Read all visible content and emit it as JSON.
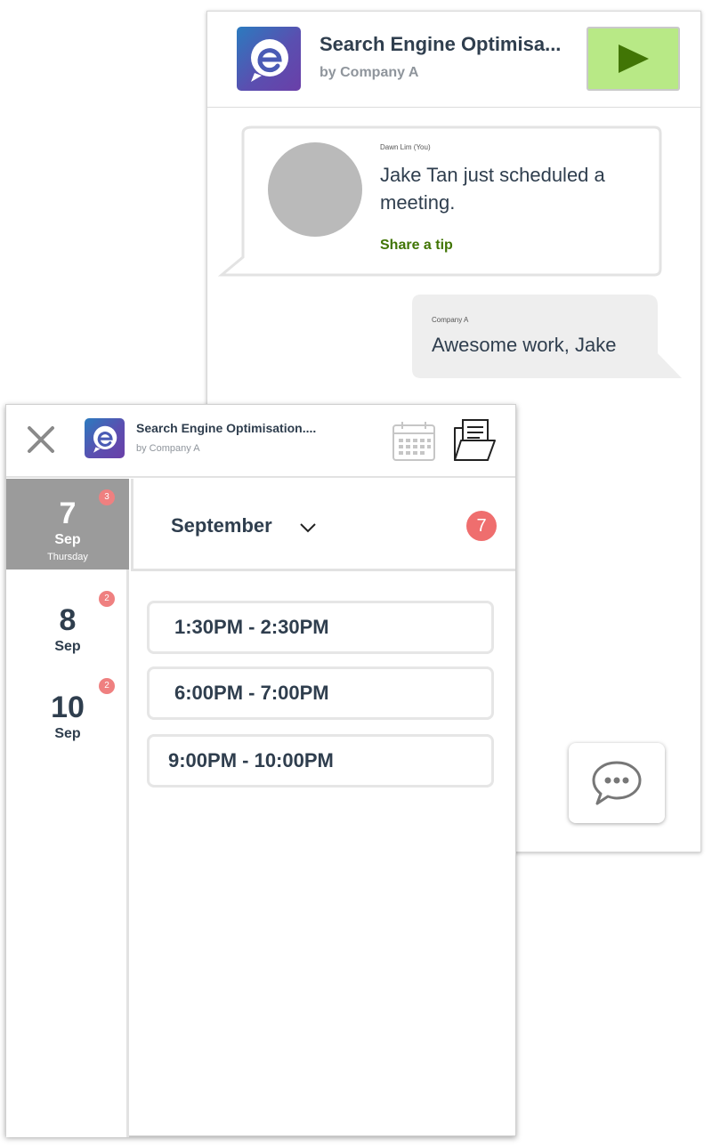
{
  "chat_panel": {
    "app_title": "Search Engine Optimisa...",
    "app_subtitle": "by Company A",
    "messages": [
      {
        "sender": "Dawn Lim (You)",
        "text": "Jake Tan just scheduled a meeting.",
        "action": "Share a tip"
      },
      {
        "sender": "Company A",
        "text": "Awesome work, Jake"
      }
    ],
    "icons": {
      "logo": "app-logo-e",
      "play": "play-icon",
      "chat": "chat-bubble-icon"
    },
    "colors": {
      "play_bg": "#b8e986",
      "play_icon": "#417505",
      "tip_link": "#417505"
    }
  },
  "calendar_panel": {
    "app_title": "Search Engine Optimisation....",
    "app_subtitle": "by Company A",
    "icons": {
      "close": "close-icon",
      "calendar": "calendar-icon",
      "folder": "folder-icon"
    },
    "dates": [
      {
        "day": "7",
        "month": "Sep",
        "weekday": "Thursday",
        "count": "3",
        "active": true
      },
      {
        "day": "8",
        "month": "Sep",
        "count": "2"
      },
      {
        "day": "10",
        "month": "Sep",
        "count": "2"
      }
    ],
    "month": "September",
    "total_count": "7",
    "slots": [
      "1:30PM - 2:30PM",
      "6:00PM - 7:00PM",
      "9:00PM - 10:00PM"
    ],
    "colors": {
      "badge": "#ef6e6e",
      "active_date_bg": "#9b9b9b"
    }
  }
}
